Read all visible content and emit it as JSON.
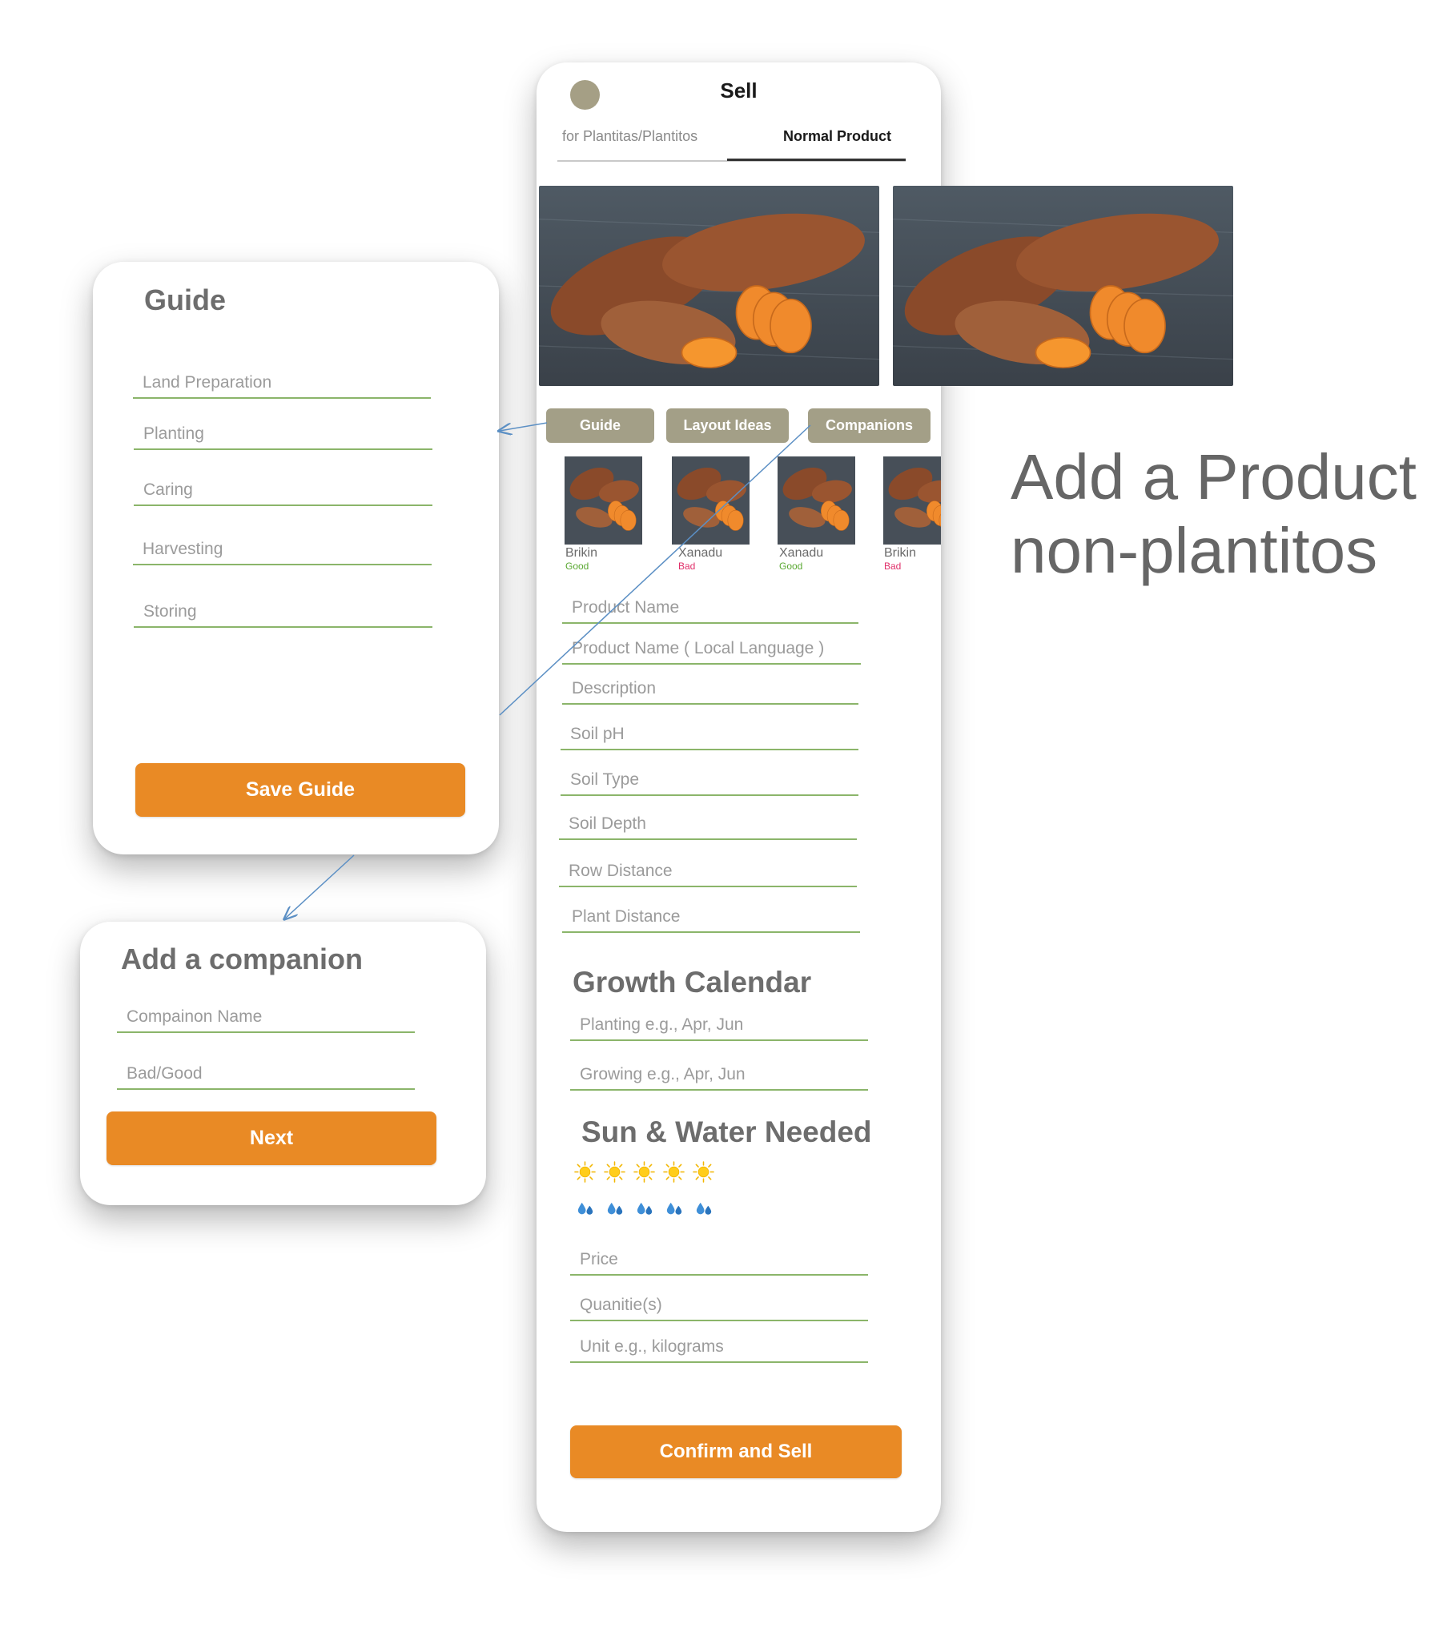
{
  "sell_screen": {
    "title": "Sell",
    "tabs": [
      {
        "label": "for Plantitas/Plantitos",
        "active": false
      },
      {
        "label": "Normal Product",
        "active": true
      }
    ],
    "photos": [
      "sweet-potato-photo-1",
      "sweet-potato-photo-2"
    ],
    "action_chips": [
      "Guide",
      "Layout Ideas",
      "Companions"
    ],
    "companions": [
      {
        "name": "Brikin",
        "rating": "Good",
        "rating_color": "#5aa832"
      },
      {
        "name": "Xanadu",
        "rating": "Bad",
        "rating_color": "#e0306a"
      },
      {
        "name": "Xanadu",
        "rating": "Good",
        "rating_color": "#5aa832"
      },
      {
        "name": "Brikin",
        "rating": "Bad",
        "rating_color": "#e0306a"
      }
    ],
    "fields": {
      "product_name": "Product Name",
      "product_name_local": "Product Name ( Local Language )",
      "description": "Description",
      "soil_ph": "Soil pH",
      "soil_type": "Soil Type",
      "soil_depth": "Soil Depth",
      "row_distance": "Row Distance",
      "plant_distance": "Plant Distance"
    },
    "growth_calendar": {
      "heading": "Growth Calendar",
      "planting_placeholder": "Planting e.g.,  Apr, Jun",
      "growing_placeholder": "Growing  e.g.,  Apr, Jun"
    },
    "sun_water": {
      "heading": "Sun & Water Needed",
      "sun_count": 5,
      "water_count": 5
    },
    "price_placeholder": "Price",
    "quantity_placeholder": "Quanitie(s)",
    "unit_placeholder": "Unit e.g., kilograms",
    "confirm_button": "Confirm and Sell"
  },
  "guide_panel": {
    "title": "Guide",
    "fields": [
      "Land Preparation",
      "Planting",
      "Caring",
      "Harvesting",
      "Storing"
    ],
    "save_button": "Save Guide"
  },
  "companion_panel": {
    "title": "Add a companion",
    "name_placeholder": "Compainon Name",
    "rating_placeholder": "Bad/Good",
    "next_button": "Next"
  },
  "caption": {
    "line1": "Add a Product",
    "line2": "non-plantitos"
  },
  "colors": {
    "accent_orange": "#e98a25",
    "chip_khaki": "#a39f87",
    "underline_green": "#8bb56a",
    "connector_blue": "#5b8fc4"
  }
}
